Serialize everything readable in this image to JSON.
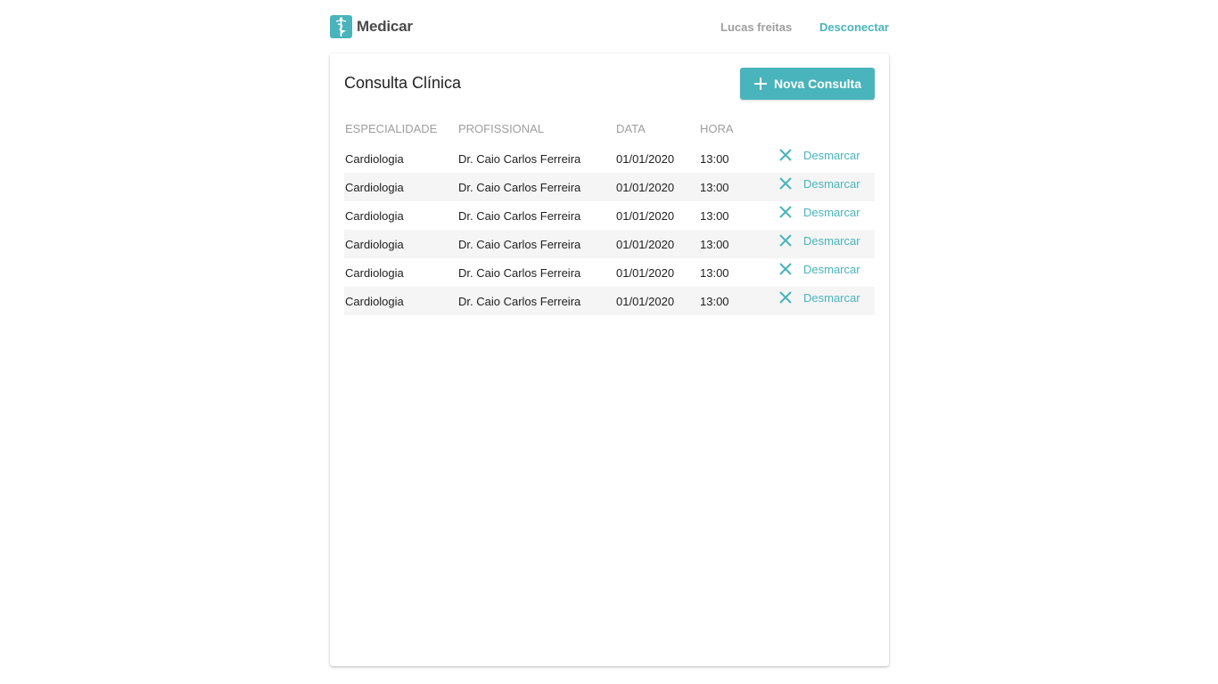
{
  "header": {
    "brand": "Medicar",
    "user_name": "Lucas freitas",
    "logout_label": "Desconectar"
  },
  "main": {
    "title": "Consulta Clínica",
    "new_button_label": "Nova Consulta",
    "columns": [
      "ESPECIALIDADE",
      "PROFISSIONAL",
      "DATA",
      "HORA"
    ],
    "rows": [
      {
        "especialidade": "Cardiologia",
        "profissional": "Dr. Caio Carlos Ferreira",
        "data": "01/01/2020",
        "hora": "13:00",
        "action": "Desmarcar"
      },
      {
        "especialidade": "Cardiologia",
        "profissional": "Dr. Caio Carlos Ferreira",
        "data": "01/01/2020",
        "hora": "13:00",
        "action": "Desmarcar"
      },
      {
        "especialidade": "Cardiologia",
        "profissional": "Dr. Caio Carlos Ferreira",
        "data": "01/01/2020",
        "hora": "13:00",
        "action": "Desmarcar"
      },
      {
        "especialidade": "Cardiologia",
        "profissional": "Dr. Caio Carlos Ferreira",
        "data": "01/01/2020",
        "hora": "13:00",
        "action": "Desmarcar"
      },
      {
        "especialidade": "Cardiologia",
        "profissional": "Dr. Caio Carlos Ferreira",
        "data": "01/01/2020",
        "hora": "13:00",
        "action": "Desmarcar"
      },
      {
        "especialidade": "Cardiologia",
        "profissional": "Dr. Caio Carlos Ferreira",
        "data": "01/01/2020",
        "hora": "13:00",
        "action": "Desmarcar"
      }
    ]
  },
  "icons": {
    "logo": "caduceus-icon",
    "add": "plus-icon",
    "cancel": "close-icon"
  },
  "colors": {
    "accent": "#49b4bb",
    "text_muted": "#9e9e9e",
    "row_stripe": "#f5f5f5"
  }
}
